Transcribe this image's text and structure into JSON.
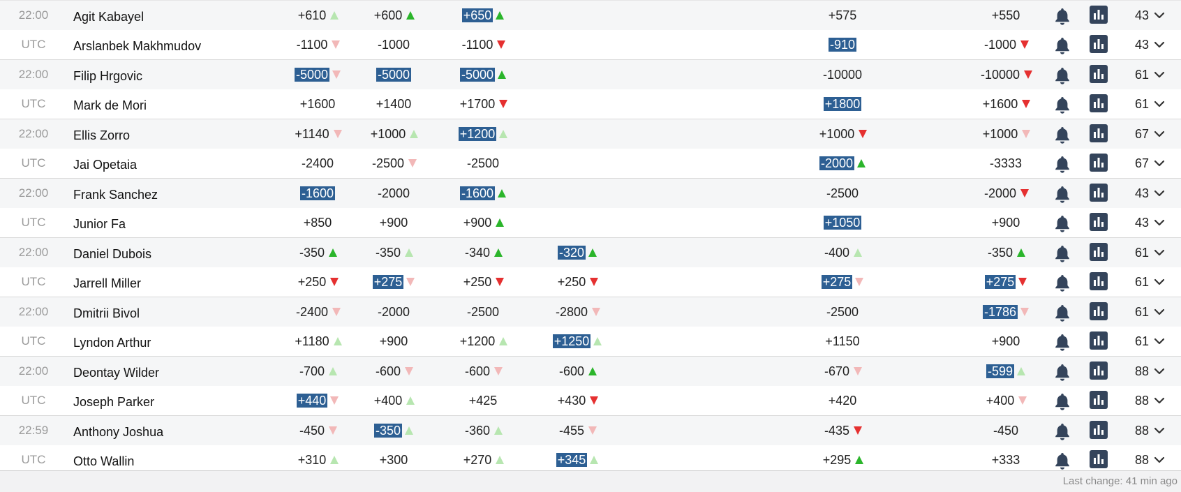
{
  "colors": {
    "highlight_bg": "#2d5f93",
    "up_strong": "#2bb52b",
    "up_light": "#b7e6b0",
    "down_strong": "#e53030",
    "down_light": "#f2b8b8",
    "icon": "#34445b"
  },
  "icons": {
    "alert": "bell-icon",
    "stats": "bar-chart-icon",
    "expand": "chevron-down-icon"
  },
  "fights": [
    {
      "count": "43",
      "rows": [
        {
          "time": "22:00",
          "name": "Agit Kabayel",
          "odds": [
            {
              "v": "+610",
              "h": false,
              "a": "up-light"
            },
            {
              "v": "+600",
              "h": false,
              "a": "up-strong"
            },
            {
              "v": "+650",
              "h": true,
              "a": "up-strong"
            },
            {
              "v": "",
              "h": false,
              "a": ""
            },
            {
              "v": "+575",
              "h": false,
              "a": ""
            },
            {
              "v": "+550",
              "h": false,
              "a": ""
            }
          ]
        },
        {
          "time": "UTC",
          "name": "Arslanbek Makhmudov",
          "odds": [
            {
              "v": "-1100",
              "h": false,
              "a": "down-light"
            },
            {
              "v": "-1000",
              "h": false,
              "a": ""
            },
            {
              "v": "-1100",
              "h": false,
              "a": "down-strong"
            },
            {
              "v": "",
              "h": false,
              "a": ""
            },
            {
              "v": "-910",
              "h": true,
              "a": ""
            },
            {
              "v": "-1000",
              "h": false,
              "a": "down-strong"
            }
          ]
        }
      ]
    },
    {
      "count": "61",
      "rows": [
        {
          "time": "22:00",
          "name": "Filip Hrgovic",
          "odds": [
            {
              "v": "-5000",
              "h": true,
              "a": "down-light"
            },
            {
              "v": "-5000",
              "h": true,
              "a": ""
            },
            {
              "v": "-5000",
              "h": true,
              "a": "up-strong"
            },
            {
              "v": "",
              "h": false,
              "a": ""
            },
            {
              "v": "-10000",
              "h": false,
              "a": ""
            },
            {
              "v": "-10000",
              "h": false,
              "a": "down-strong"
            }
          ]
        },
        {
          "time": "UTC",
          "name": "Mark de Mori",
          "odds": [
            {
              "v": "+1600",
              "h": false,
              "a": ""
            },
            {
              "v": "+1400",
              "h": false,
              "a": ""
            },
            {
              "v": "+1700",
              "h": false,
              "a": "down-strong"
            },
            {
              "v": "",
              "h": false,
              "a": ""
            },
            {
              "v": "+1800",
              "h": true,
              "a": ""
            },
            {
              "v": "+1600",
              "h": false,
              "a": "down-strong"
            }
          ]
        }
      ]
    },
    {
      "count": "67",
      "rows": [
        {
          "time": "22:00",
          "name": "Ellis Zorro",
          "odds": [
            {
              "v": "+1140",
              "h": false,
              "a": "down-light"
            },
            {
              "v": "+1000",
              "h": false,
              "a": "up-light"
            },
            {
              "v": "+1200",
              "h": true,
              "a": "up-light"
            },
            {
              "v": "",
              "h": false,
              "a": ""
            },
            {
              "v": "+1000",
              "h": false,
              "a": "down-strong"
            },
            {
              "v": "+1000",
              "h": false,
              "a": "down-light"
            }
          ]
        },
        {
          "time": "UTC",
          "name": "Jai Opetaia",
          "odds": [
            {
              "v": "-2400",
              "h": false,
              "a": ""
            },
            {
              "v": "-2500",
              "h": false,
              "a": "down-light"
            },
            {
              "v": "-2500",
              "h": false,
              "a": ""
            },
            {
              "v": "",
              "h": false,
              "a": ""
            },
            {
              "v": "-2000",
              "h": true,
              "a": "up-strong"
            },
            {
              "v": "-3333",
              "h": false,
              "a": ""
            }
          ]
        }
      ]
    },
    {
      "count": "43",
      "rows": [
        {
          "time": "22:00",
          "name": "Frank Sanchez",
          "odds": [
            {
              "v": "-1600",
              "h": true,
              "a": ""
            },
            {
              "v": "-2000",
              "h": false,
              "a": ""
            },
            {
              "v": "-1600",
              "h": true,
              "a": "up-strong"
            },
            {
              "v": "",
              "h": false,
              "a": ""
            },
            {
              "v": "-2500",
              "h": false,
              "a": ""
            },
            {
              "v": "-2000",
              "h": false,
              "a": "down-strong"
            }
          ]
        },
        {
          "time": "UTC",
          "name": "Junior Fa",
          "odds": [
            {
              "v": "+850",
              "h": false,
              "a": ""
            },
            {
              "v": "+900",
              "h": false,
              "a": ""
            },
            {
              "v": "+900",
              "h": false,
              "a": "up-strong"
            },
            {
              "v": "",
              "h": false,
              "a": ""
            },
            {
              "v": "+1050",
              "h": true,
              "a": ""
            },
            {
              "v": "+900",
              "h": false,
              "a": ""
            }
          ]
        }
      ]
    },
    {
      "count": "61",
      "rows": [
        {
          "time": "22:00",
          "name": "Daniel Dubois",
          "odds": [
            {
              "v": "-350",
              "h": false,
              "a": "up-strong"
            },
            {
              "v": "-350",
              "h": false,
              "a": "up-light"
            },
            {
              "v": "-340",
              "h": false,
              "a": "up-strong"
            },
            {
              "v": "-320",
              "h": true,
              "a": "up-strong"
            },
            {
              "v": "-400",
              "h": false,
              "a": "up-light"
            },
            {
              "v": "-350",
              "h": false,
              "a": "up-strong"
            }
          ]
        },
        {
          "time": "UTC",
          "name": "Jarrell Miller",
          "odds": [
            {
              "v": "+250",
              "h": false,
              "a": "down-strong"
            },
            {
              "v": "+275",
              "h": true,
              "a": "down-light"
            },
            {
              "v": "+250",
              "h": false,
              "a": "down-strong"
            },
            {
              "v": "+250",
              "h": false,
              "a": "down-strong"
            },
            {
              "v": "+275",
              "h": true,
              "a": "down-light"
            },
            {
              "v": "+275",
              "h": true,
              "a": "down-strong"
            }
          ]
        }
      ]
    },
    {
      "count": "61",
      "rows": [
        {
          "time": "22:00",
          "name": "Dmitrii Bivol",
          "odds": [
            {
              "v": "-2400",
              "h": false,
              "a": "down-light"
            },
            {
              "v": "-2000",
              "h": false,
              "a": ""
            },
            {
              "v": "-2500",
              "h": false,
              "a": ""
            },
            {
              "v": "-2800",
              "h": false,
              "a": "down-light"
            },
            {
              "v": "-2500",
              "h": false,
              "a": ""
            },
            {
              "v": "-1786",
              "h": true,
              "a": "down-light"
            }
          ]
        },
        {
          "time": "UTC",
          "name": "Lyndon Arthur",
          "odds": [
            {
              "v": "+1180",
              "h": false,
              "a": "up-light"
            },
            {
              "v": "+900",
              "h": false,
              "a": ""
            },
            {
              "v": "+1200",
              "h": false,
              "a": "up-light"
            },
            {
              "v": "+1250",
              "h": true,
              "a": "up-light"
            },
            {
              "v": "+1150",
              "h": false,
              "a": ""
            },
            {
              "v": "+900",
              "h": false,
              "a": ""
            }
          ]
        }
      ]
    },
    {
      "count": "88",
      "rows": [
        {
          "time": "22:00",
          "name": "Deontay Wilder",
          "odds": [
            {
              "v": "-700",
              "h": false,
              "a": "up-light"
            },
            {
              "v": "-600",
              "h": false,
              "a": "down-light"
            },
            {
              "v": "-600",
              "h": false,
              "a": "down-light"
            },
            {
              "v": "-600",
              "h": false,
              "a": "up-strong"
            },
            {
              "v": "-670",
              "h": false,
              "a": "down-light"
            },
            {
              "v": "-599",
              "h": true,
              "a": "up-light"
            }
          ]
        },
        {
          "time": "UTC",
          "name": "Joseph Parker",
          "odds": [
            {
              "v": "+440",
              "h": true,
              "a": "down-light"
            },
            {
              "v": "+400",
              "h": false,
              "a": "up-light"
            },
            {
              "v": "+425",
              "h": false,
              "a": ""
            },
            {
              "v": "+430",
              "h": false,
              "a": "down-strong"
            },
            {
              "v": "+420",
              "h": false,
              "a": ""
            },
            {
              "v": "+400",
              "h": false,
              "a": "down-light"
            }
          ]
        }
      ]
    },
    {
      "count": "88",
      "rows": [
        {
          "time": "22:59",
          "name": "Anthony Joshua",
          "odds": [
            {
              "v": "-450",
              "h": false,
              "a": "down-light"
            },
            {
              "v": "-350",
              "h": true,
              "a": "up-light"
            },
            {
              "v": "-360",
              "h": false,
              "a": "up-light"
            },
            {
              "v": "-455",
              "h": false,
              "a": "down-light"
            },
            {
              "v": "-435",
              "h": false,
              "a": "down-strong"
            },
            {
              "v": "-450",
              "h": false,
              "a": ""
            }
          ]
        },
        {
          "time": "UTC",
          "name": "Otto Wallin",
          "odds": [
            {
              "v": "+310",
              "h": false,
              "a": "up-light"
            },
            {
              "v": "+300",
              "h": false,
              "a": ""
            },
            {
              "v": "+270",
              "h": false,
              "a": "up-light"
            },
            {
              "v": "+345",
              "h": true,
              "a": "up-light"
            },
            {
              "v": "+295",
              "h": false,
              "a": "up-strong"
            },
            {
              "v": "+333",
              "h": false,
              "a": ""
            }
          ]
        }
      ]
    }
  ],
  "footer": {
    "last_change": "Last change: 41 min ago"
  }
}
